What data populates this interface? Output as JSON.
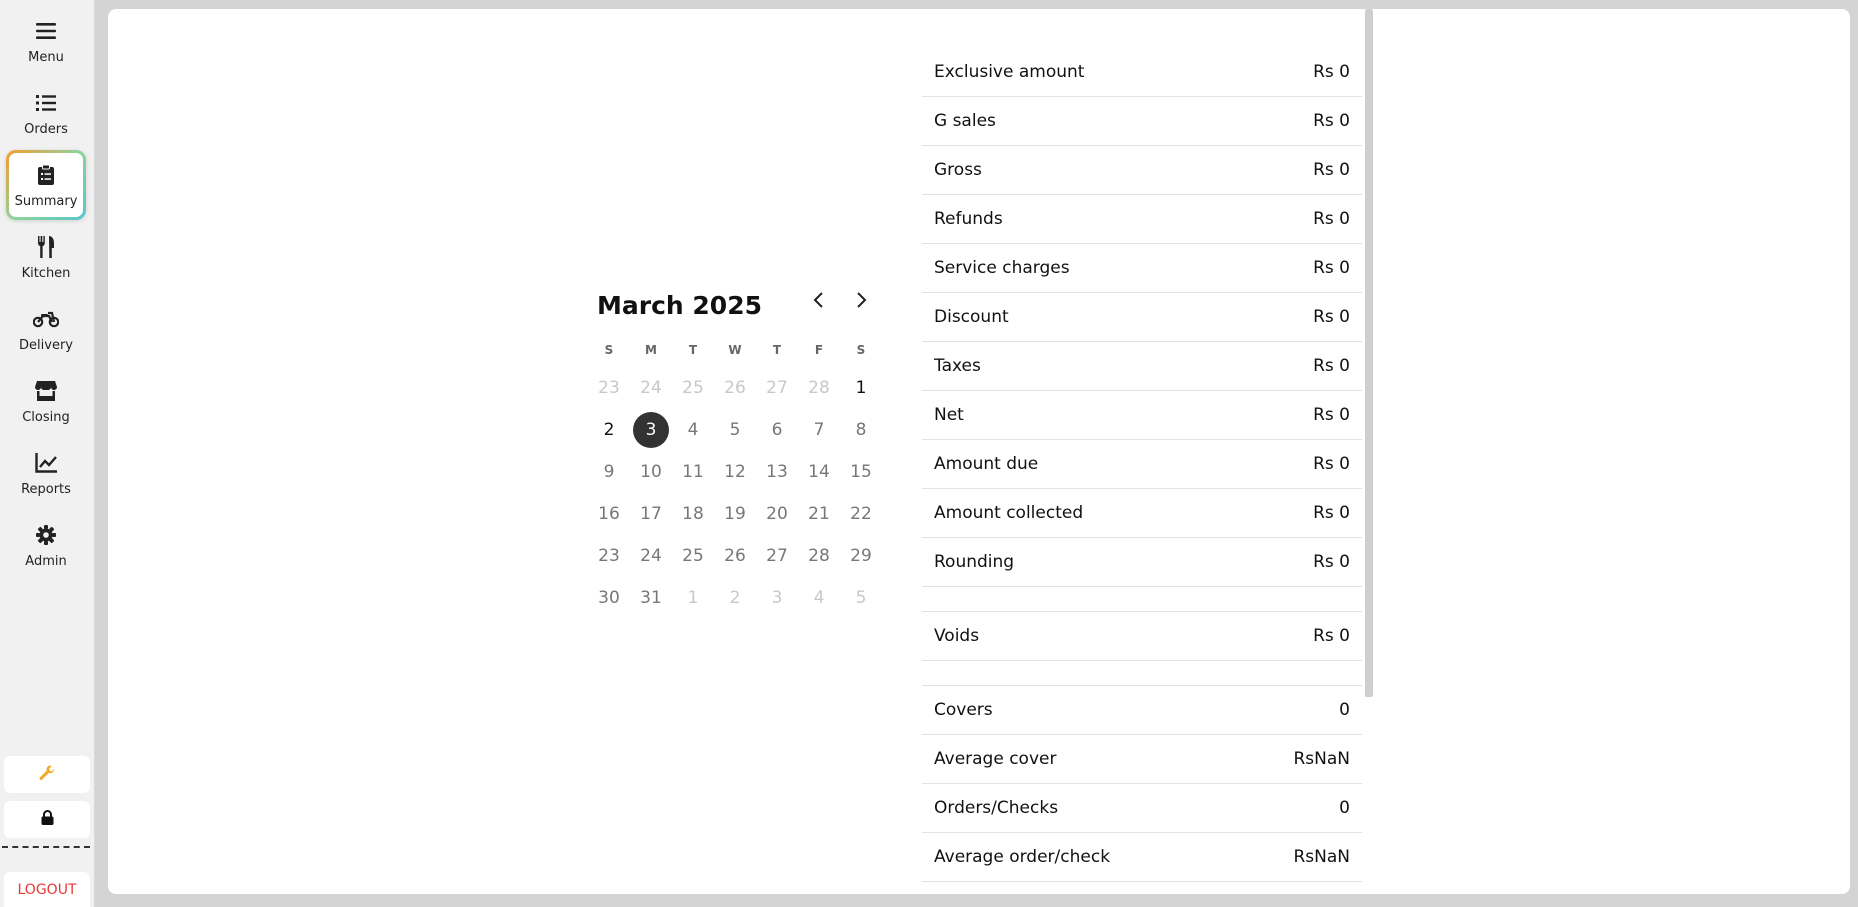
{
  "sidebar": {
    "items": [
      {
        "label": "Menu",
        "icon": "hamburger-icon"
      },
      {
        "label": "Orders",
        "icon": "list-icon"
      },
      {
        "label": "Summary",
        "icon": "clipboard-icon",
        "active": true
      },
      {
        "label": "Kitchen",
        "icon": "utensils-icon"
      },
      {
        "label": "Delivery",
        "icon": "motorcycle-icon"
      },
      {
        "label": "Closing",
        "icon": "store-icon"
      },
      {
        "label": "Reports",
        "icon": "chart-line-icon"
      },
      {
        "label": "Admin",
        "icon": "gear-icon"
      }
    ],
    "tools": [
      "wrench-icon",
      "lock-icon"
    ],
    "logout_label": "LOGOUT",
    "accent_color": "#f5a623",
    "logout_color": "#e53935"
  },
  "calendar": {
    "title": "March 2025",
    "weekdays": [
      "S",
      "M",
      "T",
      "W",
      "T",
      "F",
      "S"
    ],
    "weeks": [
      [
        {
          "d": "23",
          "m": true
        },
        {
          "d": "24",
          "m": true
        },
        {
          "d": "25",
          "m": true
        },
        {
          "d": "26",
          "m": true
        },
        {
          "d": "27",
          "m": true
        },
        {
          "d": "28",
          "m": true
        },
        {
          "d": "1",
          "s": true
        }
      ],
      [
        {
          "d": "2",
          "s": true
        },
        {
          "d": "3",
          "sel": true
        },
        {
          "d": "4"
        },
        {
          "d": "5"
        },
        {
          "d": "6"
        },
        {
          "d": "7"
        },
        {
          "d": "8"
        }
      ],
      [
        {
          "d": "9"
        },
        {
          "d": "10"
        },
        {
          "d": "11"
        },
        {
          "d": "12"
        },
        {
          "d": "13"
        },
        {
          "d": "14"
        },
        {
          "d": "15"
        }
      ],
      [
        {
          "d": "16"
        },
        {
          "d": "17"
        },
        {
          "d": "18"
        },
        {
          "d": "19"
        },
        {
          "d": "20"
        },
        {
          "d": "21"
        },
        {
          "d": "22"
        }
      ],
      [
        {
          "d": "23"
        },
        {
          "d": "24"
        },
        {
          "d": "25"
        },
        {
          "d": "26"
        },
        {
          "d": "27"
        },
        {
          "d": "28"
        },
        {
          "d": "29"
        }
      ],
      [
        {
          "d": "30"
        },
        {
          "d": "31"
        },
        {
          "d": "1",
          "m": true
        },
        {
          "d": "2",
          "m": true
        },
        {
          "d": "3",
          "m": true
        },
        {
          "d": "4",
          "m": true
        },
        {
          "d": "5",
          "m": true
        }
      ]
    ]
  },
  "summary": {
    "rows": [
      {
        "label": "Exclusive amount",
        "value": "Rs 0"
      },
      {
        "label": "G sales",
        "value": "Rs 0"
      },
      {
        "label": "Gross",
        "value": "Rs 0"
      },
      {
        "label": "Refunds",
        "value": "Rs 0"
      },
      {
        "label": "Service charges",
        "value": "Rs 0"
      },
      {
        "label": "Discount",
        "value": "Rs 0"
      },
      {
        "label": "Taxes",
        "value": "Rs 0"
      },
      {
        "label": "Net",
        "value": "Rs 0"
      },
      {
        "label": "Amount due",
        "value": "Rs 0"
      },
      {
        "label": "Amount collected",
        "value": "Rs 0"
      },
      {
        "label": "Rounding",
        "value": "Rs 0"
      },
      {
        "spacer": true
      },
      {
        "label": "Voids",
        "value": "Rs 0"
      },
      {
        "spacer": true
      },
      {
        "label": "Covers",
        "value": "0"
      },
      {
        "label": "Average cover",
        "value": "RsNaN"
      },
      {
        "label": "Orders/Checks",
        "value": "0"
      },
      {
        "label": "Average order/check",
        "value": "RsNaN"
      }
    ]
  }
}
